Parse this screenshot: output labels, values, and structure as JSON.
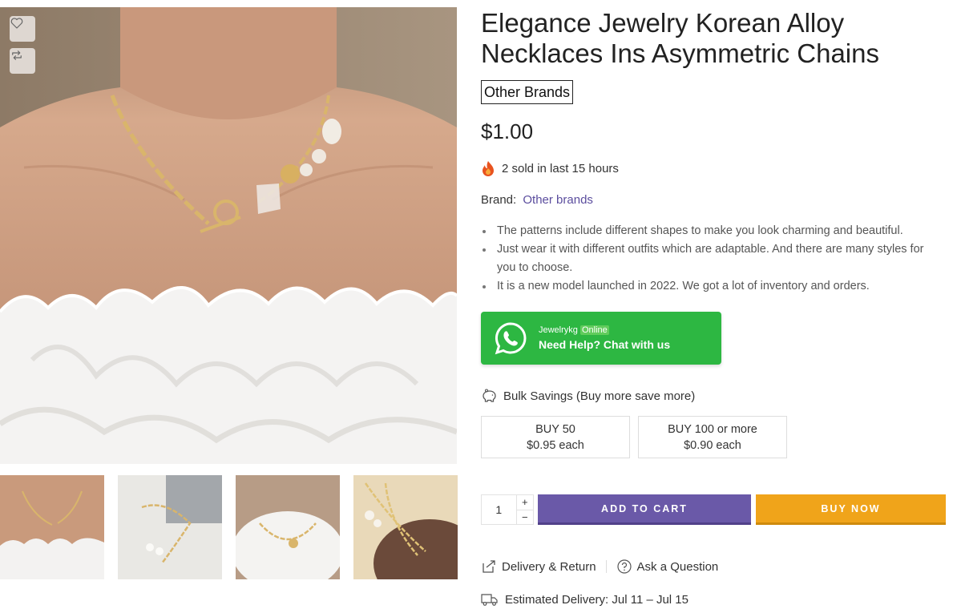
{
  "product": {
    "title": "Elegance Jewelry Korean Alloy Necklaces Ins Asymmetric Chains",
    "brand_badge": "Other Brands",
    "price": "$1.00",
    "sold_text": "2 sold in last 15 hours",
    "brand_label": "Brand:",
    "brand_value": "Other brands",
    "features": [
      "The patterns include different shapes to make you look charming and beautiful.",
      "Just wear it with different outfits which are adaptable. And there are many styles for you to choose.",
      "It is a new model launched in 2022. We got a lot of inventory and orders."
    ]
  },
  "whatsapp": {
    "name": "Jewelrykg",
    "status": "Online",
    "cta": "Need Help? Chat with us",
    "color": "#2db742"
  },
  "bulk": {
    "title": "Bulk Savings (Buy more save more)",
    "tiers": [
      {
        "qty": "BUY 50",
        "price": "$0.95 each"
      },
      {
        "qty": "BUY 100 or more",
        "price": "$0.90 each"
      }
    ]
  },
  "cart": {
    "quantity": "1",
    "plus": "+",
    "minus": "−",
    "add_to_cart": "ADD TO CART",
    "buy_now": "BUY NOW",
    "add_color": "#6a59a8",
    "buy_color": "#f0a41a"
  },
  "links": {
    "delivery_return": "Delivery & Return",
    "ask_question": "Ask a Question",
    "estimated_delivery": "Estimated Delivery: Jul 11 – Jul 15"
  },
  "icons": {
    "wishlist": "heart-icon",
    "compare": "compare-arrows-icon",
    "fire": "fire-icon",
    "whatsapp": "whatsapp-icon",
    "bulk": "piggy-bank-icon",
    "delivery": "delivery-return-icon",
    "question": "question-icon",
    "truck": "truck-icon"
  }
}
